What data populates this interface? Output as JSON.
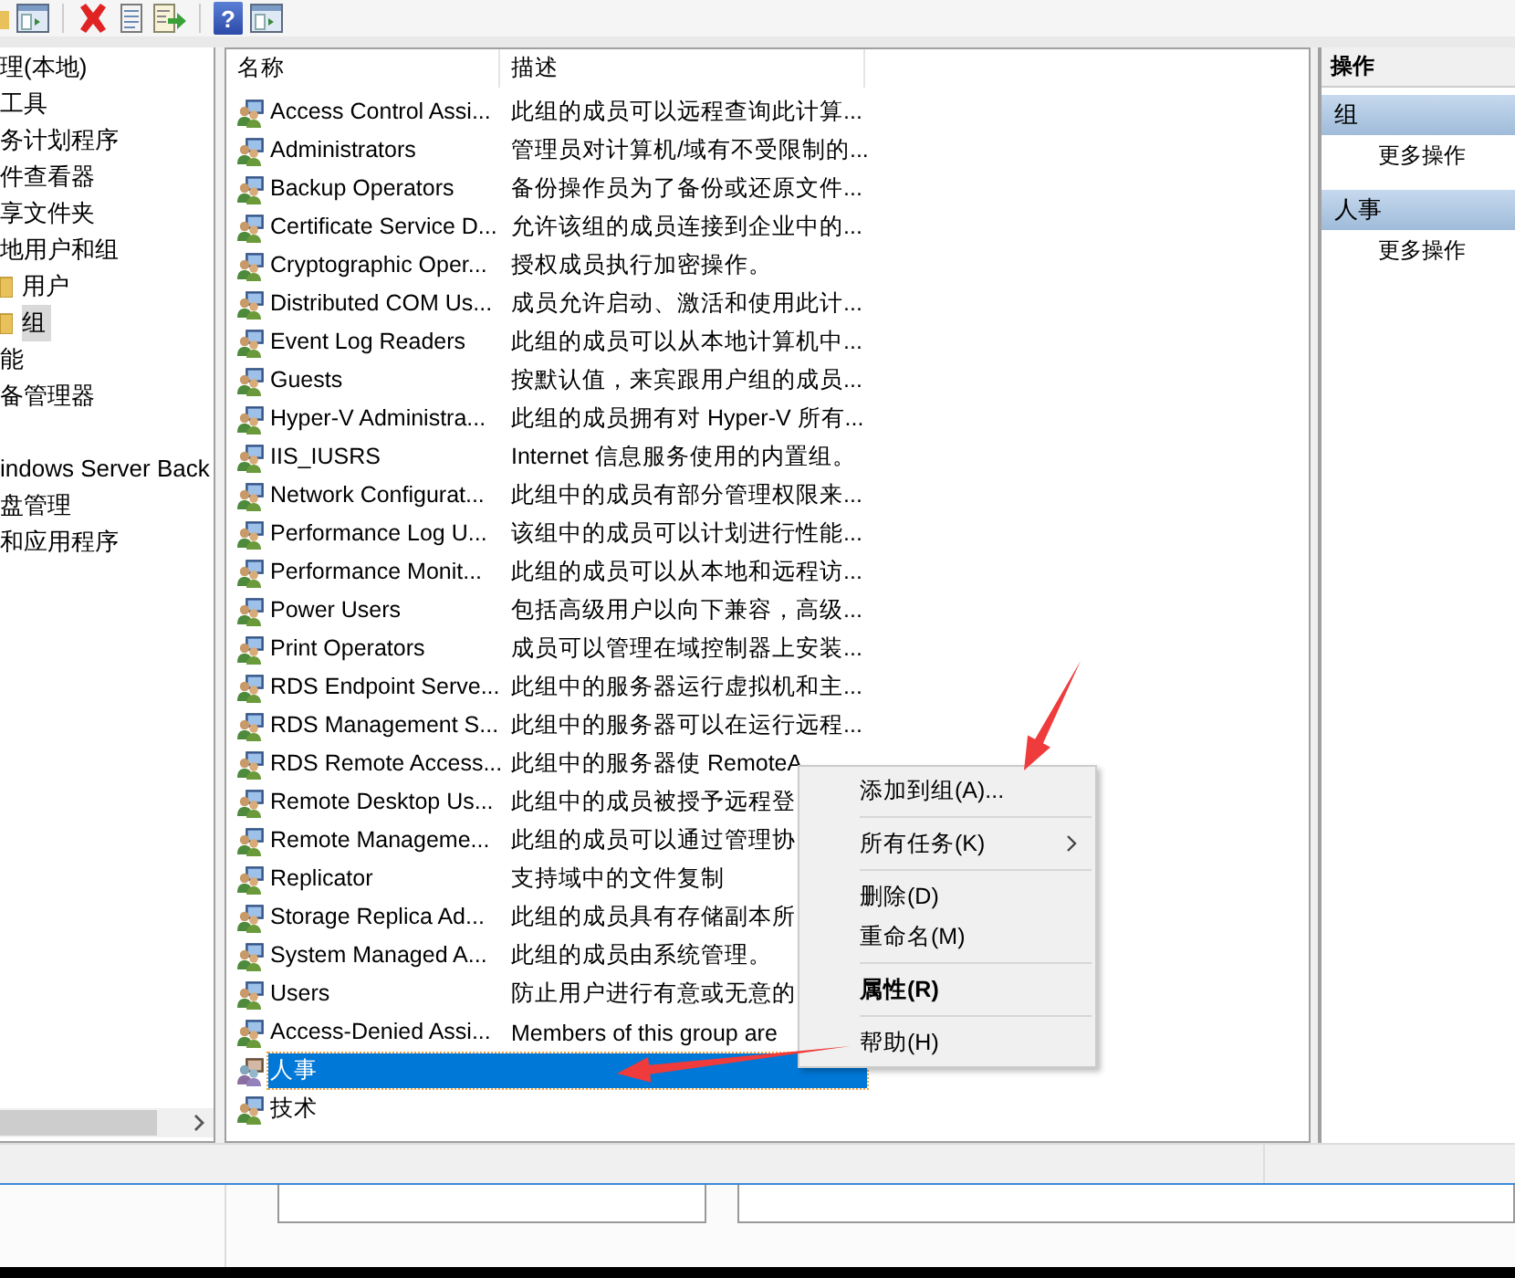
{
  "toolbar": [
    {
      "kind": "folder"
    },
    {
      "kind": "pane"
    },
    {
      "kind": "separator"
    },
    {
      "kind": "delete"
    },
    {
      "kind": "properties"
    },
    {
      "kind": "export"
    },
    {
      "kind": "separator"
    },
    {
      "kind": "help",
      "label": "?"
    },
    {
      "kind": "pane"
    }
  ],
  "tree": [
    {
      "label": "理(本地)",
      "selected": false
    },
    {
      "label": "工具",
      "selected": false
    },
    {
      "label": "务计划程序",
      "selected": false
    },
    {
      "label": "件查看器",
      "selected": false
    },
    {
      "label": "享文件夹",
      "selected": false
    },
    {
      "label": "地用户和组",
      "selected": false,
      "children": [
        {
          "label": "用户",
          "selected": false
        },
        {
          "label": "组",
          "selected": true
        }
      ]
    },
    {
      "label": "能",
      "selected": false
    },
    {
      "label": "备管理器",
      "selected": false
    },
    {
      "label": "indows Server Back",
      "selected": false
    },
    {
      "label": "盘管理",
      "selected": false
    },
    {
      "label": "和应用程序",
      "selected": false
    }
  ],
  "list": {
    "columns": [
      "名称",
      "描述"
    ],
    "rows": [
      {
        "name": "Access Control Assi...",
        "description": "此组的成员可以远程查询此计算...",
        "selected": false
      },
      {
        "name": "Administrators",
        "description": "管理员对计算机/域有不受限制的...",
        "selected": false
      },
      {
        "name": "Backup Operators",
        "description": "备份操作员为了备份或还原文件...",
        "selected": false
      },
      {
        "name": "Certificate Service D...",
        "description": "允许该组的成员连接到企业中的...",
        "selected": false
      },
      {
        "name": "Cryptographic Oper...",
        "description": "授权成员执行加密操作。",
        "selected": false
      },
      {
        "name": "Distributed COM Us...",
        "description": "成员允许启动、激活和使用此计...",
        "selected": false
      },
      {
        "name": "Event Log Readers",
        "description": "此组的成员可以从本地计算机中...",
        "selected": false
      },
      {
        "name": "Guests",
        "description": "按默认值，来宾跟用户组的成员...",
        "selected": false
      },
      {
        "name": "Hyper-V Administra...",
        "description": "此组的成员拥有对 Hyper-V 所有...",
        "selected": false
      },
      {
        "name": "IIS_IUSRS",
        "description": "Internet 信息服务使用的内置组。",
        "selected": false
      },
      {
        "name": "Network Configurat...",
        "description": "此组中的成员有部分管理权限来...",
        "selected": false
      },
      {
        "name": "Performance Log U...",
        "description": "该组中的成员可以计划进行性能...",
        "selected": false
      },
      {
        "name": "Performance Monit...",
        "description": "此组的成员可以从本地和远程访...",
        "selected": false
      },
      {
        "name": "Power Users",
        "description": "包括高级用户以向下兼容，高级...",
        "selected": false
      },
      {
        "name": "Print Operators",
        "description": "成员可以管理在域控制器上安装...",
        "selected": false
      },
      {
        "name": "RDS Endpoint Serve...",
        "description": "此组中的服务器运行虚拟机和主...",
        "selected": false
      },
      {
        "name": "RDS Management S...",
        "description": "此组中的服务器可以在运行远程...",
        "selected": false
      },
      {
        "name": "RDS Remote Access...",
        "description": "此组中的服务器使 RemoteA",
        "selected": false
      },
      {
        "name": "Remote Desktop Us...",
        "description": "此组中的成员被授予远程登",
        "selected": false
      },
      {
        "name": "Remote Manageme...",
        "description": "此组的成员可以通过管理协",
        "selected": false
      },
      {
        "name": "Replicator",
        "description": "支持域中的文件复制",
        "selected": false
      },
      {
        "name": "Storage Replica Ad...",
        "description": "此组的成员具有存储副本所",
        "selected": false
      },
      {
        "name": "System Managed A...",
        "description": "此组的成员由系统管理。",
        "selected": false
      },
      {
        "name": "Users",
        "description": "防止用户进行有意或无意的",
        "selected": false
      },
      {
        "name": "Access-Denied Assi...",
        "description": "Members of this group are",
        "selected": false
      },
      {
        "name": "人事",
        "selected": true
      },
      {
        "name": "技术",
        "selected": false
      }
    ]
  },
  "actions": {
    "title": "操作",
    "sections": [
      {
        "title": "组",
        "items": [
          "更多操作"
        ]
      },
      {
        "title": "人事",
        "items": [
          "更多操作"
        ]
      }
    ]
  },
  "context_menu": {
    "groups": [
      [
        {
          "label": "添加到组(A)...",
          "bold": false,
          "submenu": false
        }
      ],
      [
        {
          "label": "所有任务(K)",
          "bold": false,
          "submenu": true
        }
      ],
      [
        {
          "label": "删除(D)",
          "bold": false,
          "submenu": false
        },
        {
          "label": "重命名(M)",
          "bold": false,
          "submenu": false
        }
      ],
      [
        {
          "label": "属性(R)",
          "bold": true,
          "submenu": false
        }
      ],
      [
        {
          "label": "帮助(H)",
          "bold": false,
          "submenu": false
        }
      ]
    ]
  },
  "annotations": [
    {
      "kind": "arrow"
    },
    {
      "kind": "arrow"
    }
  ]
}
